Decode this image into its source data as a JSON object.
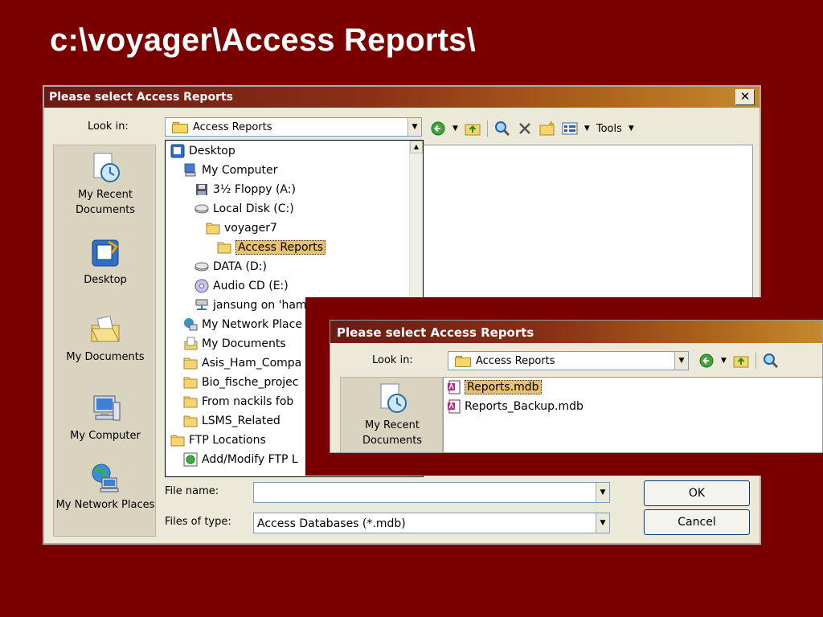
{
  "slide": {
    "title": "c:\\voyager\\Access Reports\\"
  },
  "dialog": {
    "title": "Please select Access Reports",
    "close_glyph": "✕",
    "look_in_label": "Look in:",
    "look_in_value": "Access Reports",
    "tools_label": "Tools",
    "places": [
      {
        "label": "My Recent Documents",
        "icon": "recent-documents-icon"
      },
      {
        "label": "Desktop",
        "icon": "desktop-icon"
      },
      {
        "label": "My Documents",
        "icon": "my-documents-icon"
      },
      {
        "label": "My Computer",
        "icon": "my-computer-icon"
      },
      {
        "label": "My Network Places",
        "icon": "network-places-icon"
      }
    ],
    "tree": [
      {
        "label": "Desktop",
        "icon": "desktop-icon"
      },
      {
        "label": "My Computer",
        "icon": "my-computer-icon"
      },
      {
        "label": "3½ Floppy (A:)",
        "icon": "floppy-icon"
      },
      {
        "label": "Local Disk (C:)",
        "icon": "drive-icon"
      },
      {
        "label": "voyager7",
        "icon": "folder-icon"
      },
      {
        "label": "Access Reports",
        "icon": "folder-icon",
        "selected": true
      },
      {
        "label": "DATA (D:)",
        "icon": "drive-icon"
      },
      {
        "label": "Audio CD (E:)",
        "icon": "cd-icon"
      },
      {
        "label": "jansung on 'ham",
        "icon": "network-drive-icon"
      },
      {
        "label": "My Network Place",
        "icon": "network-places-icon"
      },
      {
        "label": "My Documents",
        "icon": "my-documents-icon"
      },
      {
        "label": "Asis_Ham_Compa",
        "icon": "folder-icon"
      },
      {
        "label": "Bio_fische_projec",
        "icon": "folder-icon"
      },
      {
        "label": "From nackils fob",
        "icon": "folder-icon"
      },
      {
        "label": "LSMS_Related",
        "icon": "folder-icon"
      },
      {
        "label": "FTP Locations",
        "icon": "folder-icon"
      },
      {
        "label": "Add/Modify FTP L",
        "icon": "ftp-icon"
      }
    ],
    "file_name_label": "File name:",
    "file_name_value": "",
    "file_type_label": "Files of type:",
    "file_type_value": "Access Databases (*.mdb)",
    "ok_label": "OK",
    "cancel_label": "Cancel"
  },
  "dialog2": {
    "title": "Please select Access Reports",
    "look_in_label": "Look in:",
    "look_in_value": "Access Reports",
    "places": [
      {
        "label": "My Recent Documents",
        "icon": "recent-documents-icon"
      }
    ],
    "files": [
      {
        "name": "Reports.mdb",
        "icon": "access-db-icon",
        "selected": true
      },
      {
        "name": "Reports_Backup.mdb",
        "icon": "access-db-icon"
      }
    ]
  },
  "colors": {
    "background": "#7a0000",
    "selection": "#e8c26a",
    "dialog_face": "#ece9d8"
  }
}
